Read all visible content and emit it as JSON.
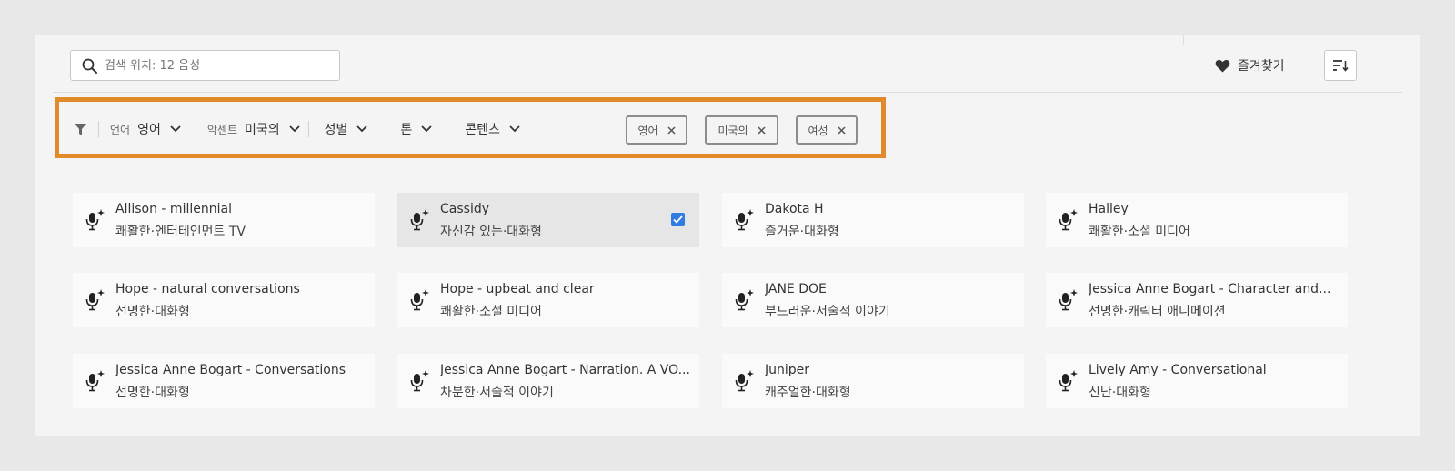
{
  "search": {
    "placeholder": "검색 위치: 12 음성",
    "value": ""
  },
  "toolbar": {
    "favorites_label": "즐겨찾기"
  },
  "filters": {
    "language": {
      "label": "언어",
      "value": "영어"
    },
    "accent": {
      "label": "악센트",
      "value": "미국의"
    },
    "gender": {
      "label": "성별"
    },
    "tone": {
      "label": "톤"
    },
    "content": {
      "label": "콘텐츠"
    },
    "chips": [
      "영어",
      "미국의",
      "여성"
    ]
  },
  "voices": [
    {
      "name": "Allison - millennial",
      "desc": "쾌활한·엔터테인먼트 TV"
    },
    {
      "name": "Cassidy",
      "desc": "자신감 있는·대화형",
      "selected": true
    },
    {
      "name": "Dakota H",
      "desc": "즐거운·대화형"
    },
    {
      "name": "Halley",
      "desc": "쾌활한·소셜 미디어"
    },
    {
      "name": "Hope - natural conversations",
      "desc": "선명한·대화형"
    },
    {
      "name": "Hope - upbeat and clear",
      "desc": "쾌활한·소셜 미디어"
    },
    {
      "name": "JANE DOE",
      "desc": "부드러운·서술적 이야기"
    },
    {
      "name": "Jessica Anne Bogart - Character and...",
      "desc": "선명한·캐릭터 애니메이션"
    },
    {
      "name": "Jessica Anne Bogart - Conversations",
      "desc": "선명한·대화형"
    },
    {
      "name": "Jessica Anne Bogart - Narration. A VO...",
      "desc": "차분한·서술적 이야기"
    },
    {
      "name": "Juniper",
      "desc": "캐주얼한·대화형"
    },
    {
      "name": "Lively Amy - Conversational",
      "desc": "신난·대화형"
    }
  ],
  "icons": {
    "search": "search-icon",
    "favorite": "heart-icon",
    "sort": "sort-icon",
    "filter": "filter-icon",
    "voice": "mic-sparkle-icon"
  },
  "colors": {
    "highlight": "#e08a2a",
    "checkbox": "#2f7de1"
  }
}
